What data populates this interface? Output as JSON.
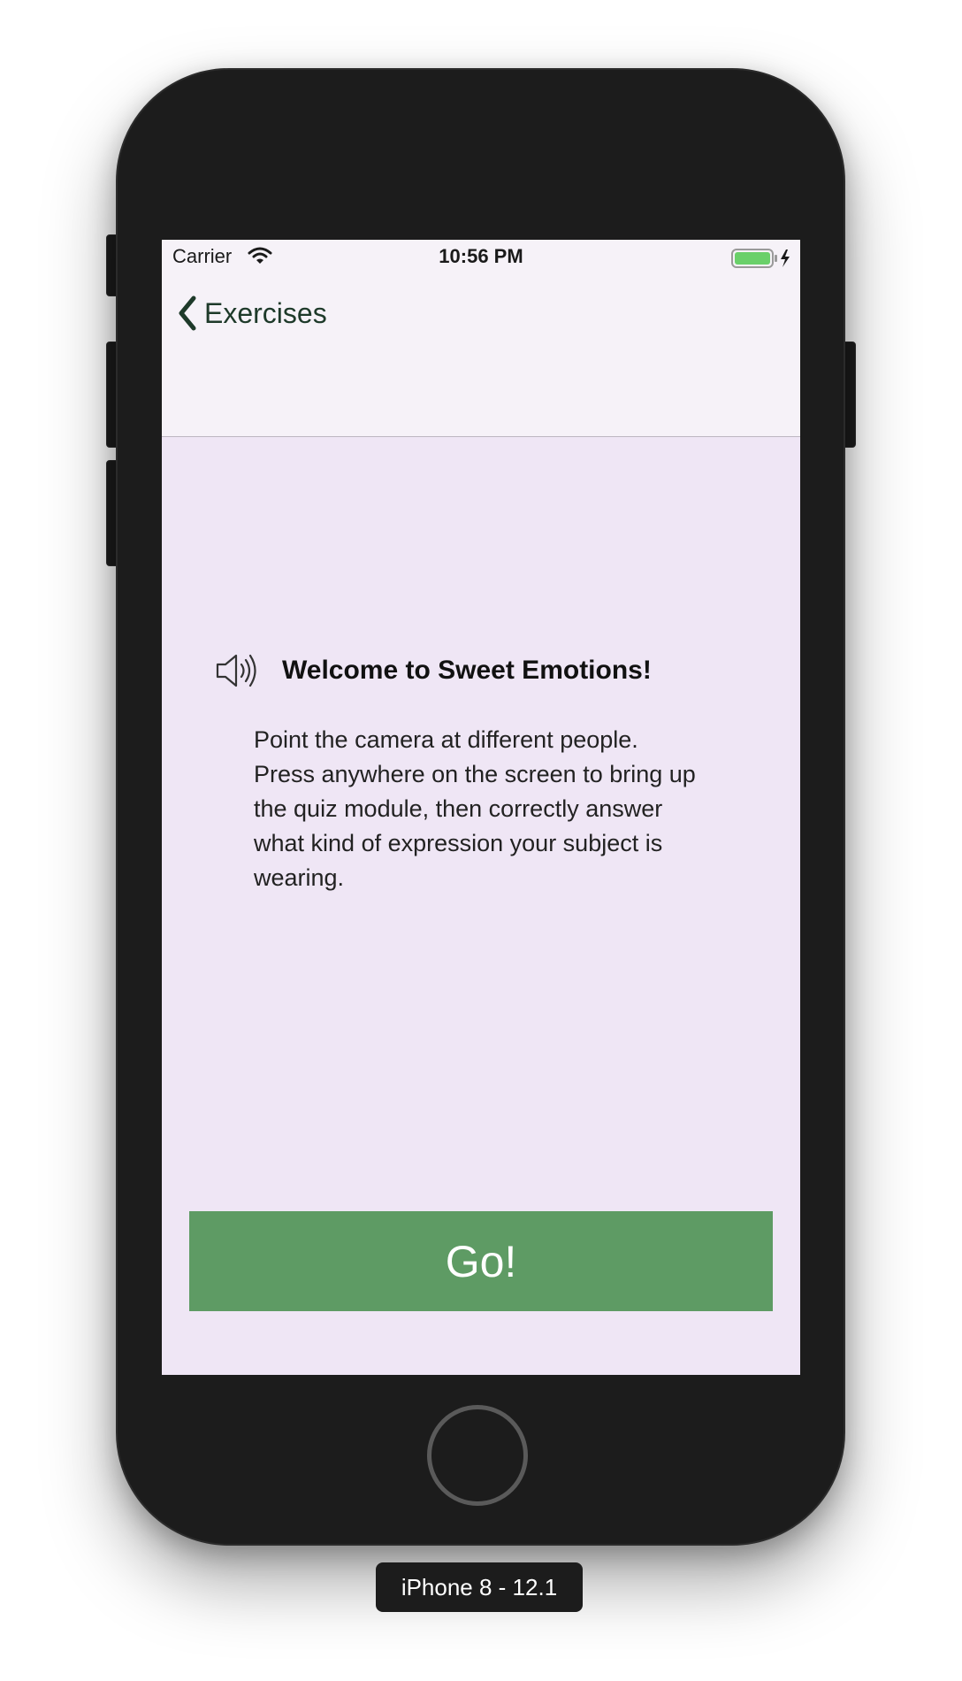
{
  "status_bar": {
    "carrier": "Carrier",
    "time": "10:56 PM",
    "wifi_icon": "wifi-icon",
    "battery_icon": "battery-charging-icon",
    "battery_color": "#6ad06a"
  },
  "nav": {
    "back_label": "Exercises",
    "back_icon": "chevron-left-icon"
  },
  "content": {
    "speaker_icon": "speaker-icon",
    "welcome_title": "Welcome to Sweet Emotions!",
    "instructions": "Point the camera at different people. Press anywhere on the screen to bring up the quiz module, then correctly answer what kind of expression your subject is wearing.",
    "go_label": "Go!"
  },
  "device": {
    "label": "iPhone 8 - 12.1"
  },
  "colors": {
    "screen_background": "#efe6f5",
    "nav_background": "#f6f2f8",
    "accent_green": "#5e9b64",
    "nav_text": "#1e3a2a",
    "device_body": "#1c1c1c"
  }
}
